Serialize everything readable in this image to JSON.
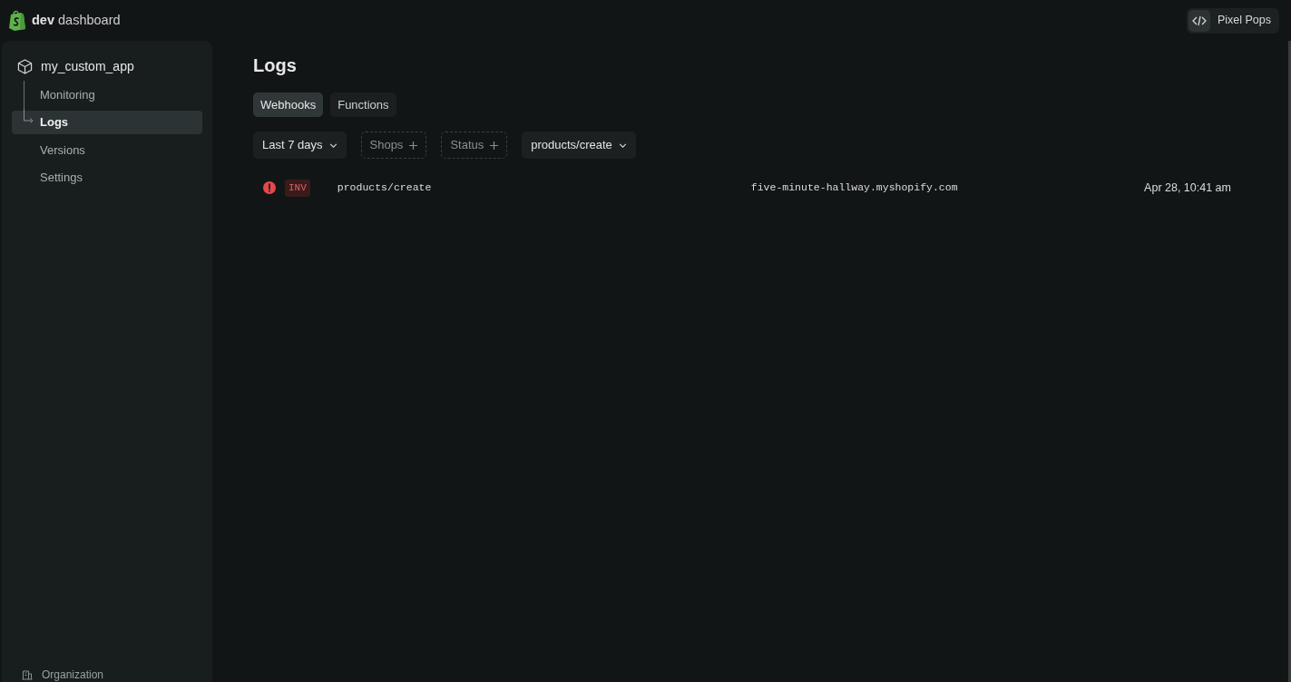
{
  "header": {
    "brand_bold": "dev",
    "brand_text": "dashboard",
    "account": {
      "label": "Pixel Pops"
    }
  },
  "sidebar": {
    "app": {
      "name": "my_custom_app"
    },
    "items": [
      {
        "label": "Monitoring",
        "selected": false
      },
      {
        "label": "Logs",
        "selected": true
      },
      {
        "label": "Versions",
        "selected": false
      },
      {
        "label": "Settings",
        "selected": false
      }
    ],
    "footer": {
      "label": "Organization"
    }
  },
  "page": {
    "title": "Logs",
    "tabs": [
      {
        "label": "Webhooks",
        "selected": true
      },
      {
        "label": "Functions",
        "selected": false
      }
    ],
    "filters": [
      {
        "label": "Last 7 days",
        "kind": "dropdown"
      },
      {
        "label": "Shops",
        "kind": "add"
      },
      {
        "label": "Status",
        "kind": "add"
      },
      {
        "label": "products/create",
        "kind": "dropdown"
      }
    ],
    "logs": [
      {
        "kind": "error",
        "badge": "INV",
        "topic": "products/create",
        "shop": "five-minute-hallway.myshopify.com",
        "time": "Apr 28, 10:41 am"
      }
    ]
  }
}
